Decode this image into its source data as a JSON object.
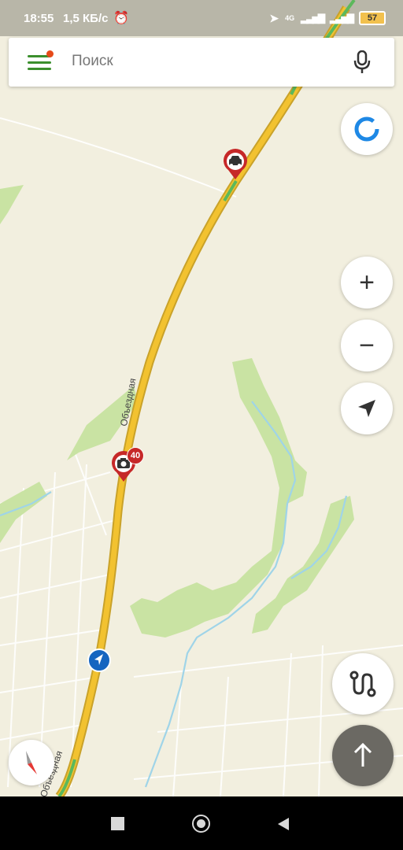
{
  "status_bar": {
    "time": "18:55",
    "network_speed": "1,5 КБ/с",
    "network_type": "4G",
    "battery": "57"
  },
  "search": {
    "placeholder": "Поиск"
  },
  "map": {
    "road_label": "Объездная",
    "road_label_bottom": "Объездная",
    "speed_camera_limit": "40"
  },
  "icons": {
    "menu": "menu-icon",
    "mic": "microphone-icon",
    "alice": "voice-assistant-icon",
    "zoom_in": "plus-icon",
    "zoom_out": "minus-icon",
    "locate": "navigation-arrow-icon",
    "route": "route-icon",
    "go": "arrow-up-icon",
    "compass": "compass-icon"
  },
  "colors": {
    "map_background": "#f2efdf",
    "park": "#c9e3a3",
    "water": "#9fd4e8",
    "road_traffic_yellow": "#f2c230",
    "road_traffic_green": "#5cb85c",
    "accent_green": "#3b8f2d",
    "marker_red": "#c62828",
    "position_blue": "#1565c0"
  }
}
